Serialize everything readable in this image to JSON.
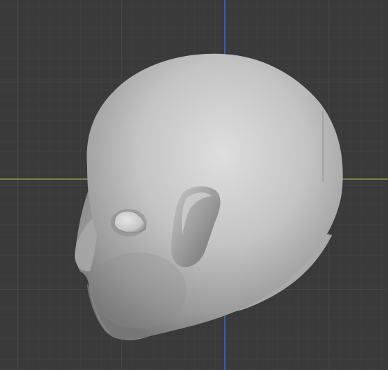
{
  "viewport": {
    "mode": "3d-viewport",
    "object": "head-sculpt",
    "view": "side",
    "colors": {
      "background": "#3a3a3a",
      "grid_minor": "#454545",
      "grid_major": "#4a4a4a",
      "x_axis": "#8aa23a",
      "z_axis": "#3f6fb8",
      "mesh_light": "#dcdcdc",
      "mesh_mid": "#b5b5b5",
      "mesh_dark": "#6e6e6e"
    }
  }
}
